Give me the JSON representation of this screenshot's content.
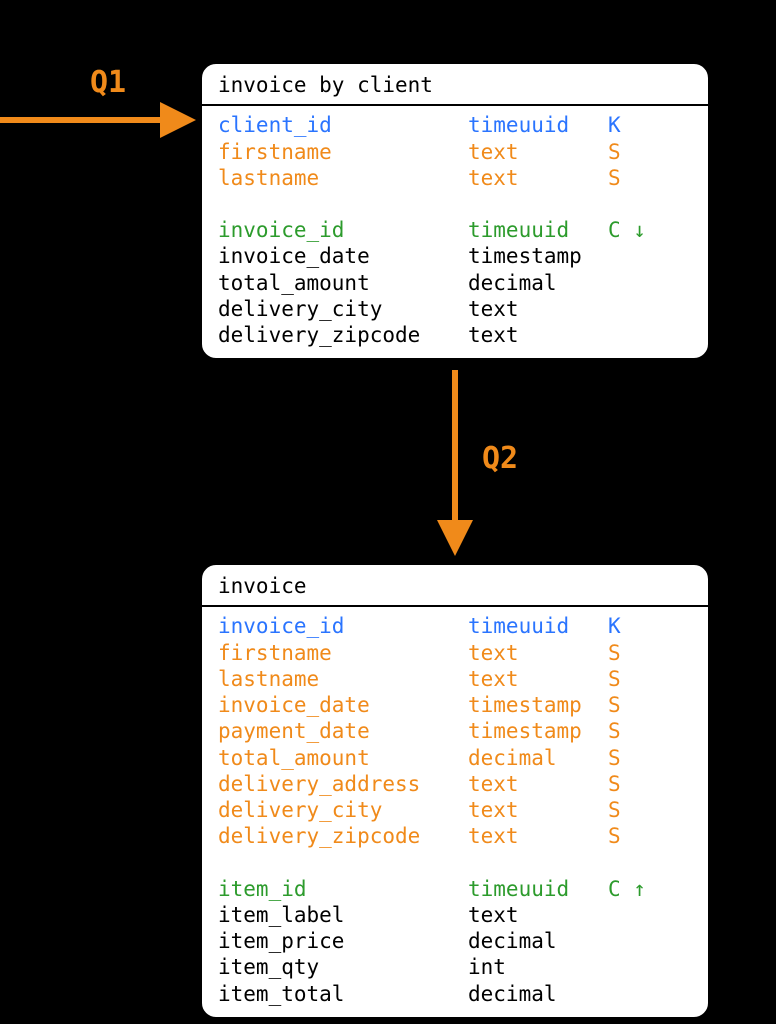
{
  "colors": {
    "accent_orange": "#f08a1a",
    "blue": "#2a74ff",
    "green": "#2c9b2c"
  },
  "arrows": {
    "q1_label": "Q1",
    "q2_label": "Q2"
  },
  "tables": [
    {
      "title": "invoice by client",
      "groups": [
        [
          {
            "name": "client_id",
            "type": "timeuuid",
            "flag": "K",
            "cls": "blue"
          },
          {
            "name": "firstname",
            "type": "text",
            "flag": "S",
            "cls": "orange"
          },
          {
            "name": "lastname",
            "type": "text",
            "flag": "S",
            "cls": "orange"
          }
        ],
        [
          {
            "name": "invoice_id",
            "type": "timeuuid",
            "flag": "C ↓",
            "cls": "green"
          },
          {
            "name": "invoice_date",
            "type": "timestamp",
            "flag": "",
            "cls": "black"
          },
          {
            "name": "total_amount",
            "type": "decimal",
            "flag": "",
            "cls": "black"
          },
          {
            "name": "delivery_city",
            "type": "text",
            "flag": "",
            "cls": "black"
          },
          {
            "name": "delivery_zipcode",
            "type": "text",
            "flag": "",
            "cls": "black"
          }
        ]
      ]
    },
    {
      "title": "invoice",
      "groups": [
        [
          {
            "name": "invoice_id",
            "type": "timeuuid",
            "flag": "K",
            "cls": "blue"
          },
          {
            "name": "firstname",
            "type": "text",
            "flag": "S",
            "cls": "orange"
          },
          {
            "name": "lastname",
            "type": "text",
            "flag": "S",
            "cls": "orange"
          },
          {
            "name": "invoice_date",
            "type": "timestamp",
            "flag": "S",
            "cls": "orange"
          },
          {
            "name": "payment_date",
            "type": "timestamp",
            "flag": "S",
            "cls": "orange"
          },
          {
            "name": "total_amount",
            "type": "decimal",
            "flag": "S",
            "cls": "orange"
          },
          {
            "name": "delivery_address",
            "type": "text",
            "flag": "S",
            "cls": "orange"
          },
          {
            "name": "delivery_city",
            "type": "text",
            "flag": "S",
            "cls": "orange"
          },
          {
            "name": "delivery_zipcode",
            "type": "text",
            "flag": "S",
            "cls": "orange"
          }
        ],
        [
          {
            "name": "item_id",
            "type": "timeuuid",
            "flag": "C ↑",
            "cls": "green"
          },
          {
            "name": "item_label",
            "type": "text",
            "flag": "",
            "cls": "black"
          },
          {
            "name": "item_price",
            "type": "decimal",
            "flag": "",
            "cls": "black"
          },
          {
            "name": "item_qty",
            "type": "int",
            "flag": "",
            "cls": "black"
          },
          {
            "name": "item_total",
            "type": "decimal",
            "flag": "",
            "cls": "black"
          }
        ]
      ]
    }
  ]
}
